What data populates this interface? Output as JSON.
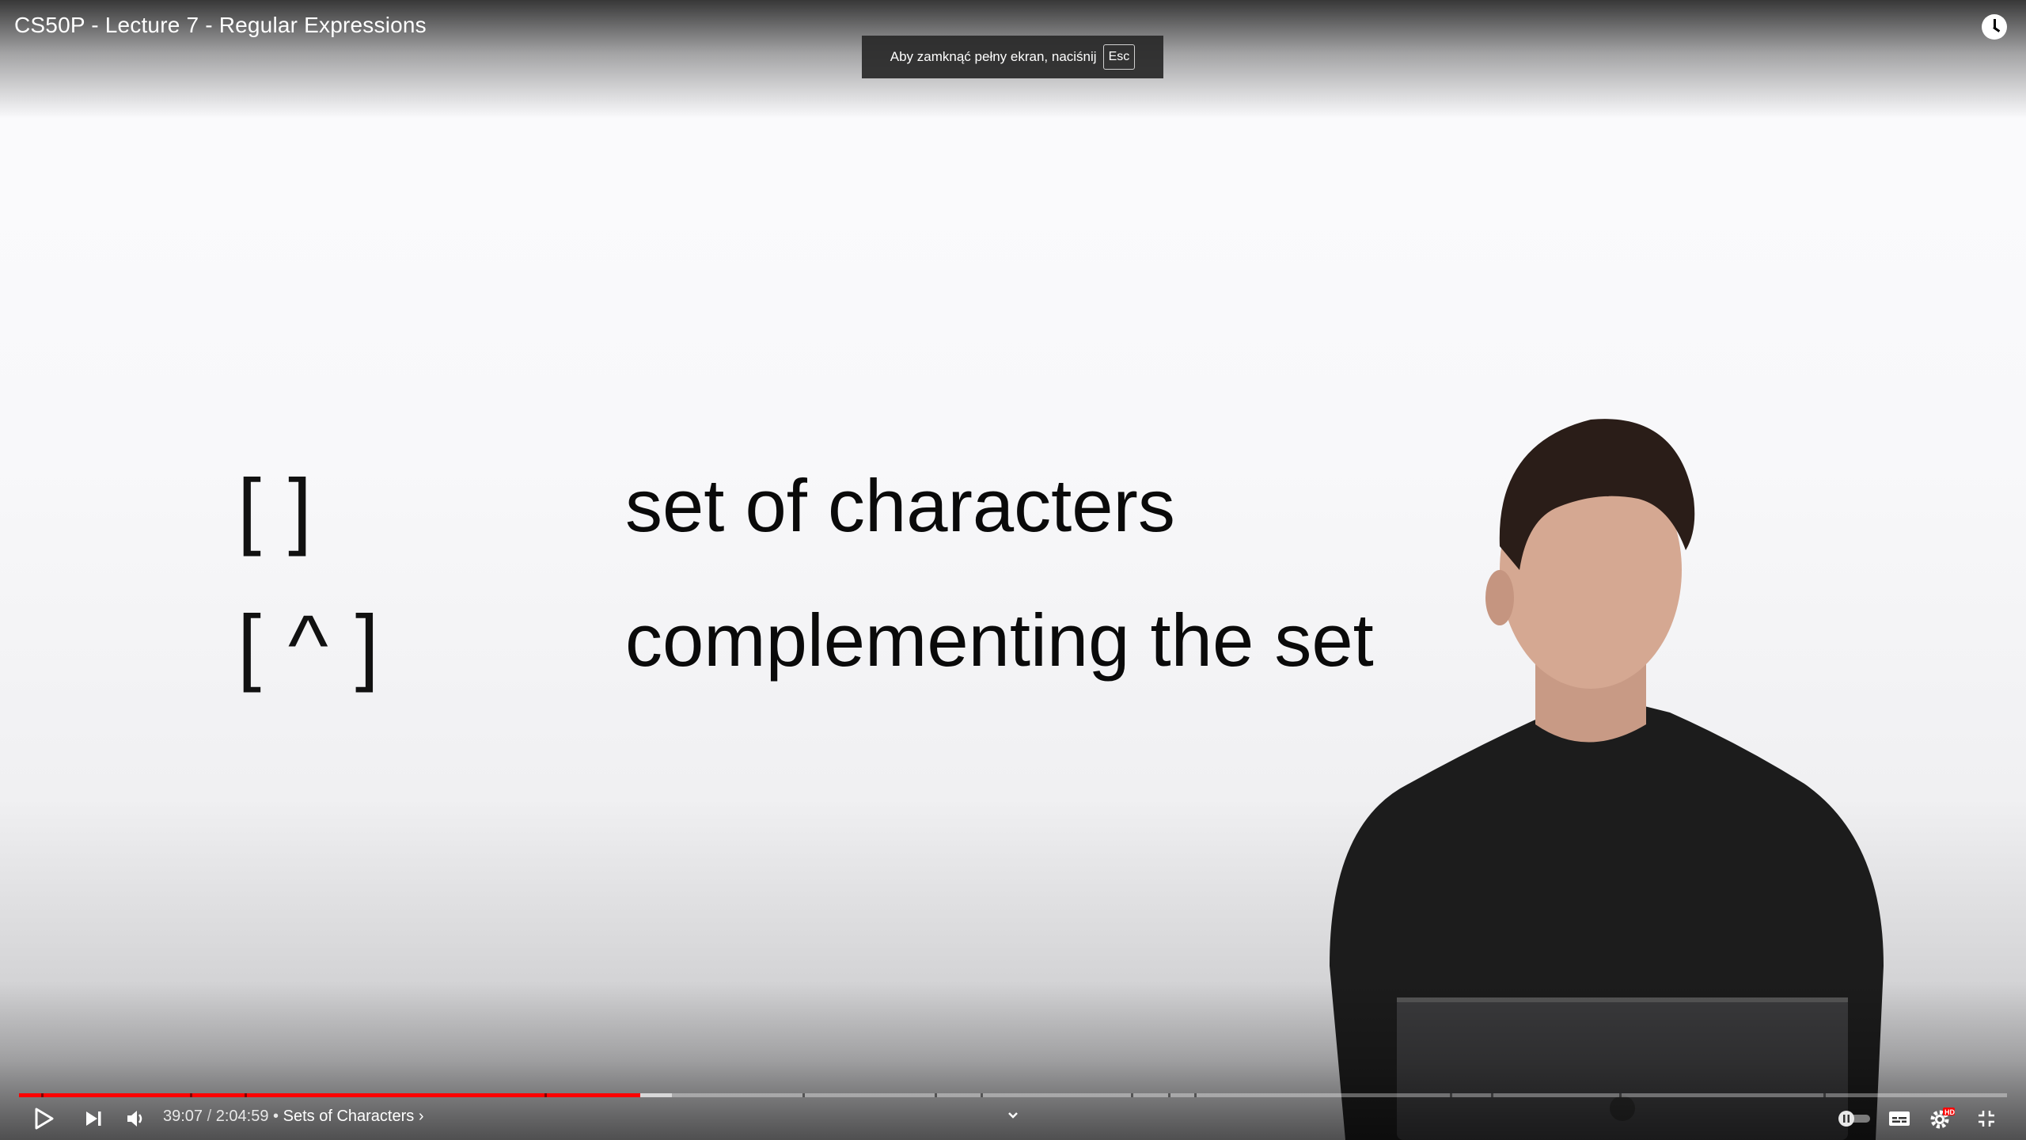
{
  "player": {
    "title": "CS50P - Lecture 7 - Regular Expressions",
    "fullscreen_toast": {
      "message": "Aby zamknąć pełny ekran, naciśnij",
      "key": "Esc"
    },
    "slide": {
      "rows": [
        {
          "symbol": "[ ]",
          "description": "set of characters"
        },
        {
          "symbol": "[ ^ ]",
          "description": "complementing the set"
        }
      ]
    },
    "controls": {
      "current_time": "39:07",
      "time_separator": "/",
      "duration": "2:04:59",
      "chapter_bullet": "•",
      "chapter_title": "Sets of Characters",
      "chapter_chevron": "›",
      "progress_played_fraction": 0.3126,
      "progress_buffered_fraction": 0.3285,
      "settings_badge": "HD"
    },
    "icons": {
      "watch_later": "clock-icon",
      "play": "play-icon",
      "next": "next-icon",
      "volume": "volume-icon",
      "chevron": "chevron-down-icon",
      "autoplay": "autoplay-toggle-icon",
      "subtitles": "subtitles-icon",
      "settings": "gear-icon",
      "exit_fullscreen": "exit-fullscreen-icon"
    },
    "colors": {
      "progress_played": "#ff0000",
      "settings_badge": "#ff0000"
    }
  }
}
